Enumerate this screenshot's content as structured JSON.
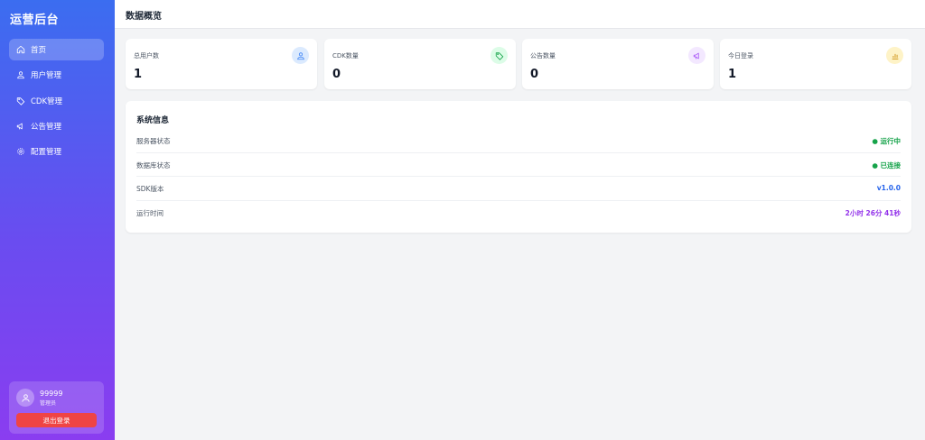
{
  "sidebar": {
    "brand": "运营后台",
    "items": [
      {
        "label": "首页",
        "icon": "home-icon"
      },
      {
        "label": "用户管理",
        "icon": "users-icon"
      },
      {
        "label": "CDK管理",
        "icon": "tag-icon"
      },
      {
        "label": "公告管理",
        "icon": "megaphone-icon"
      },
      {
        "label": "配置管理",
        "icon": "gear-icon"
      }
    ],
    "active_index": 0,
    "user": {
      "name": "99999",
      "role": "管理员"
    },
    "logout_label": "退出登录"
  },
  "header": {
    "title": "数据概览"
  },
  "stats": [
    {
      "label": "总用户数",
      "value": "1",
      "icon": "users-icon",
      "color": "#3b82f6",
      "bg": "#dbeafe"
    },
    {
      "label": "CDK数量",
      "value": "0",
      "icon": "tag-icon",
      "color": "#16a34a",
      "bg": "#dcfce7"
    },
    {
      "label": "公告数量",
      "value": "0",
      "icon": "megaphone-icon",
      "color": "#a855f7",
      "bg": "#f3e8ff"
    },
    {
      "label": "今日登录",
      "value": "1",
      "icon": "bar-chart-icon",
      "color": "#ca8a04",
      "bg": "#fef3c7"
    }
  ],
  "system_info": {
    "title": "系统信息",
    "rows": [
      {
        "label": "服务器状态",
        "value": "● 运行中",
        "color": "#16a34a"
      },
      {
        "label": "数据库状态",
        "value": "● 已连接",
        "color": "#16a34a"
      },
      {
        "label": "SDK版本",
        "value": "v1.0.0",
        "color": "#2563eb"
      },
      {
        "label": "运行时间",
        "value": "2小时 26分 41秒",
        "color": "#9333ea"
      }
    ]
  }
}
